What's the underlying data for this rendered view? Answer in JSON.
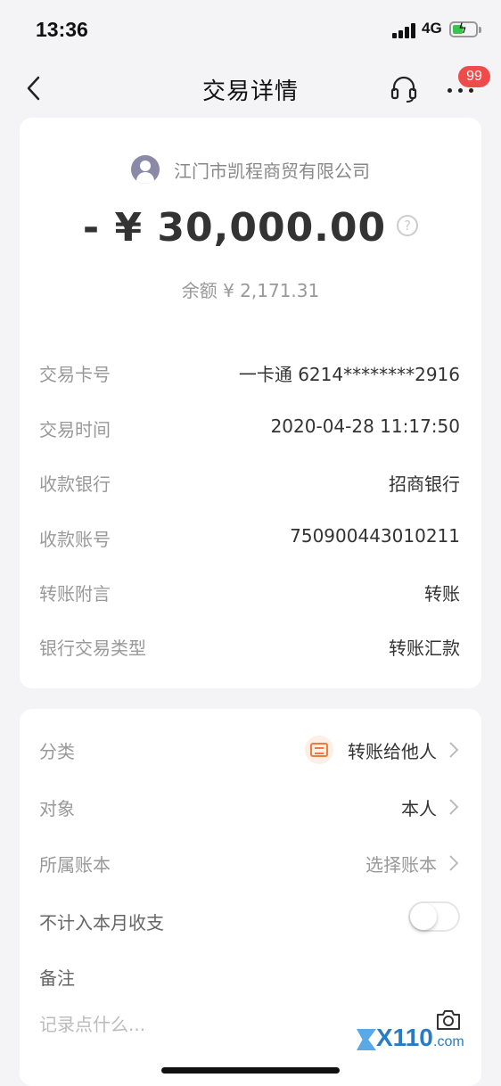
{
  "status_bar": {
    "time": "13:36",
    "network": "4G"
  },
  "nav": {
    "title": "交易详情",
    "badge_count": "99",
    "back_icon": "chevron-left-icon",
    "service_icon": "headset-icon",
    "more_icon": "more-dots-icon"
  },
  "summary": {
    "payee": "江门市凯程商贸有限公司",
    "amount": "- ¥ 30,000.00",
    "balance": "余额 ¥ 2,171.31",
    "help_symbol": "?"
  },
  "details": [
    {
      "label": "交易卡号",
      "value": "一卡通 6214********2916"
    },
    {
      "label": "交易时间",
      "value": "2020-04-28 11:17:50"
    },
    {
      "label": "收款银行",
      "value": "招商银行"
    },
    {
      "label": "收款账号",
      "value": "750900443010211"
    },
    {
      "label": "转账附言",
      "value": "转账"
    },
    {
      "label": "银行交易类型",
      "value": "转账汇款"
    }
  ],
  "settings": {
    "category": {
      "label": "分类",
      "value": "转账给他人",
      "icon": "transfer-icon",
      "accent": "#f07a3c"
    },
    "target": {
      "label": "对象",
      "value": "本人"
    },
    "ledger": {
      "label": "所属账本",
      "value": "选择账本"
    },
    "exclude": {
      "label": "不计入本月收支",
      "enabled": false
    },
    "note": {
      "label": "备注",
      "placeholder": "记录点什么..."
    }
  },
  "watermark": {
    "text": "X110",
    "domain": ".com"
  }
}
